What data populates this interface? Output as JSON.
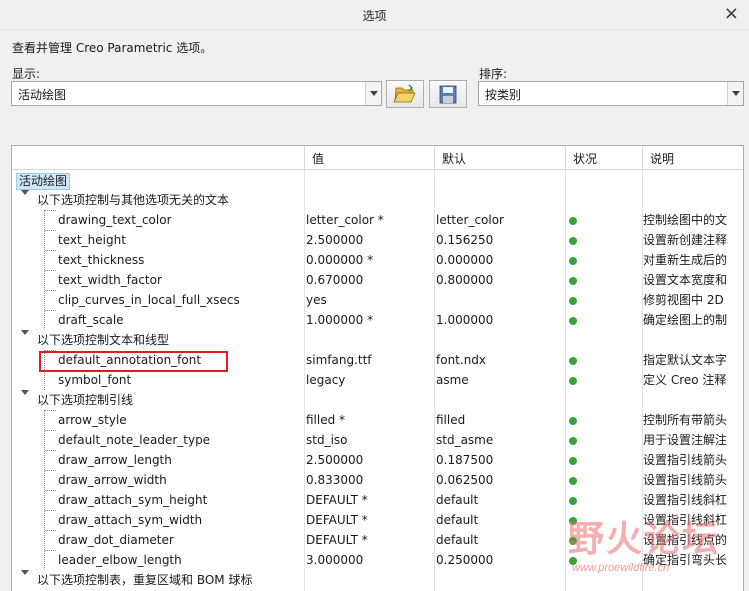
{
  "window": {
    "title": "选项"
  },
  "description": "查看并管理 Creo Parametric 选项。",
  "show": {
    "label": "显示:",
    "value": "活动绘图"
  },
  "sort": {
    "label": "排序:",
    "value": "按类别"
  },
  "columns": {
    "value": "值",
    "default": "默认",
    "status": "状况",
    "description": "说明"
  },
  "root": "活动绘图",
  "groups": [
    "以下选项控制与其他选项无关的文本",
    "以下选项控制文本和线型",
    "以下选项控制引线",
    "以下选项控制表，重复区域和 BOM 球标"
  ],
  "rows": [
    {
      "name": "drawing_text_color",
      "value": "letter_color *",
      "default": "letter_color",
      "desc": "控制绘图中的文"
    },
    {
      "name": "text_height",
      "value": "2.500000",
      "default": "0.156250",
      "desc": "设置新创建注释"
    },
    {
      "name": "text_thickness",
      "value": "0.000000 *",
      "default": "0.000000",
      "desc": "对重新生成后的"
    },
    {
      "name": "text_width_factor",
      "value": "0.670000",
      "default": "0.800000",
      "desc": "设置文本宽度和"
    },
    {
      "name": "clip_curves_in_local_full_xsecs",
      "value": "yes",
      "default": "",
      "desc": "修剪视图中 2D"
    },
    {
      "name": "draft_scale",
      "value": "1.000000 *",
      "default": "1.000000",
      "desc": "确定绘图上的制"
    },
    {
      "name": "default_annotation_font",
      "value": "simfang.ttf",
      "default": "font.ndx",
      "desc": "指定默认文本字"
    },
    {
      "name": "symbol_font",
      "value": "legacy",
      "default": "asme",
      "desc": "定义 Creo 注释"
    },
    {
      "name": "arrow_style",
      "value": "filled *",
      "default": "filled",
      "desc": "控制所有带箭头"
    },
    {
      "name": "default_note_leader_type",
      "value": "std_iso",
      "default": "std_asme",
      "desc": "用于设置注解注"
    },
    {
      "name": "draw_arrow_length",
      "value": "2.500000",
      "default": "0.187500",
      "desc": "设置指引线箭头"
    },
    {
      "name": "draw_arrow_width",
      "value": "0.833000",
      "default": "0.062500",
      "desc": "设置指引线箭头"
    },
    {
      "name": "draw_attach_sym_height",
      "value": "DEFAULT *",
      "default": "default",
      "desc": "设置指引线斜杠"
    },
    {
      "name": "draw_attach_sym_width",
      "value": "DEFAULT *",
      "default": "default",
      "desc": "设置指引线斜杠"
    },
    {
      "name": "draw_dot_diameter",
      "value": "DEFAULT *",
      "default": "default",
      "desc": "设置指引线点的"
    },
    {
      "name": "leader_elbow_length",
      "value": "3.000000",
      "default": "0.250000",
      "desc": "确定指引弯头长"
    }
  ],
  "watermark": {
    "text": "野火论坛",
    "url": "www.proewildfire.cn"
  },
  "icons": {
    "open": "folder-open-icon",
    "save": "save-disk-icon"
  },
  "colors": {
    "status_ok": "#3aa23a",
    "highlight": "#e31b23",
    "selection": "#cde8fb"
  }
}
